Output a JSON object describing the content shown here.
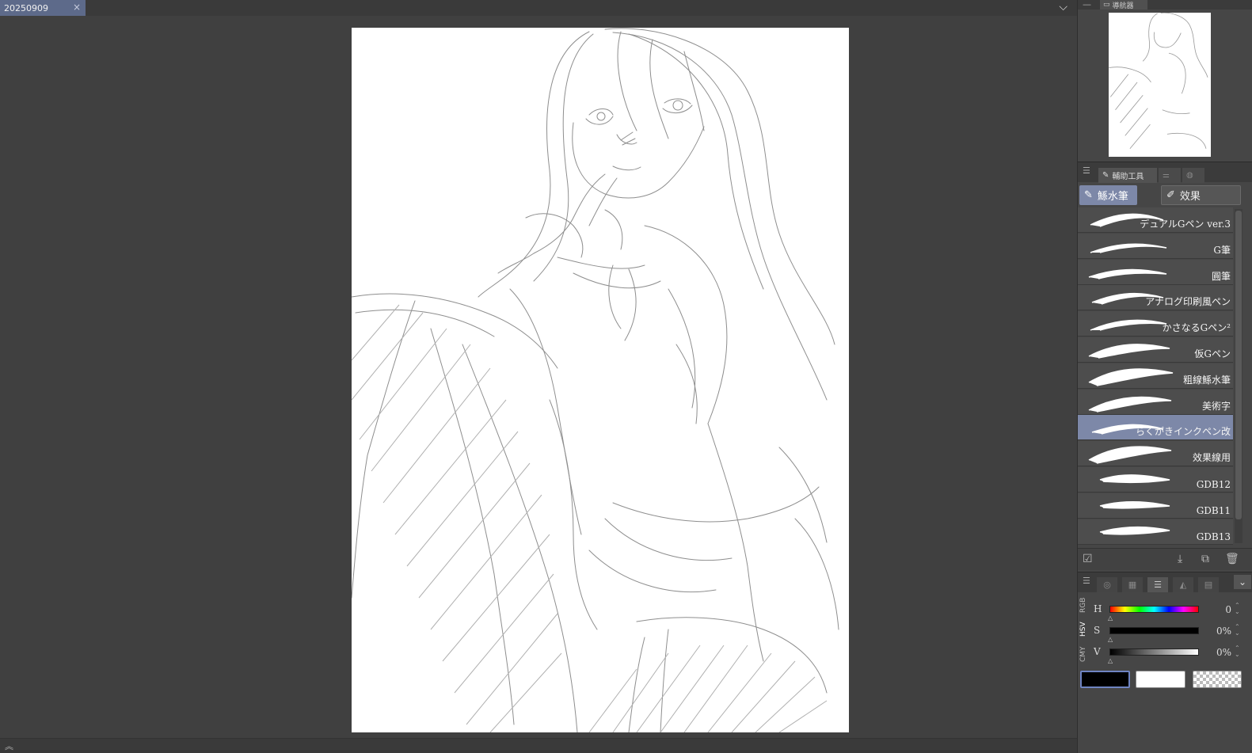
{
  "document_tab": {
    "name": "20250909",
    "close": "×"
  },
  "tab_menu_glyph": "⌵",
  "navigator": {
    "title": "導航器"
  },
  "sub_tool": {
    "title": "輔助工具",
    "groups": [
      {
        "label": "鯀水筆",
        "selected": true
      },
      {
        "label": "效果",
        "selected": false
      }
    ],
    "brushes": [
      {
        "name": "デュアルGペン ver.3",
        "selected": false
      },
      {
        "name": "G筆",
        "selected": false
      },
      {
        "name": "圓筆",
        "selected": false
      },
      {
        "name": "アナログ印刷風ペン",
        "selected": false
      },
      {
        "name": "かさなるGペン²",
        "selected": false
      },
      {
        "name": "仮Gペン",
        "selected": false
      },
      {
        "name": "粗線鯀水筆",
        "selected": false
      },
      {
        "name": "美術字",
        "selected": false
      },
      {
        "name": "らくがきインクペン改",
        "selected": true
      },
      {
        "name": "效果線用",
        "selected": false
      },
      {
        "name": "GDB12",
        "selected": false
      },
      {
        "name": "GDB11",
        "selected": false
      },
      {
        "name": "GDB13",
        "selected": false
      }
    ]
  },
  "color": {
    "modes": [
      "RGB",
      "HSV",
      "CMY"
    ],
    "active_mode": "HSV",
    "sliders": [
      {
        "label": "H",
        "value": "0"
      },
      {
        "label": "S",
        "value": "0%"
      },
      {
        "label": "V",
        "value": "0%"
      }
    ],
    "main_color": "#000000",
    "sub_color": "#ffffff"
  }
}
